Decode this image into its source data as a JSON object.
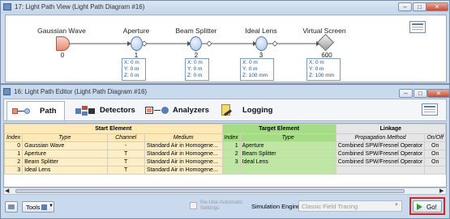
{
  "win17": {
    "title": "17: Light Path View (Light Path Diagram #16)",
    "elements": [
      {
        "name": "Gaussian Wave",
        "index": "0"
      },
      {
        "name": "Aperture",
        "index": "1",
        "x": "X: 0 m",
        "y": "Y: 0 m",
        "z": "Z: 0 m"
      },
      {
        "name": "Beam Splitter",
        "index": "2",
        "x": "X: 0 m",
        "y": "Y: 0 m",
        "z": "Z: 0 m"
      },
      {
        "name": "Ideal Lens",
        "index": "3",
        "x": "X: 0 m",
        "y": "Y: 0 m",
        "z": "Z: 100 mm"
      },
      {
        "name": "Virtual Screen",
        "index": "600",
        "x": "X: 0 m",
        "y": "Y: 0 m",
        "z": "Z: 100 mm"
      }
    ]
  },
  "win16": {
    "title": "16: Light Path Editor (Light Path Diagram #16)",
    "tabs": [
      "Path",
      "Detectors",
      "Analyzers",
      "Logging"
    ]
  },
  "grid": {
    "groups": {
      "start": "Start Element",
      "target": "Target Element",
      "linkage": "Linkage"
    },
    "headers": [
      "Index",
      "Type",
      "Channel",
      "Medium",
      "Index",
      "Type",
      "Propagation Method",
      "On/Off"
    ],
    "rows": [
      [
        "0",
        "Gaussian Wave",
        "-",
        "Standard Air in Homogene...",
        "1",
        "Aperture",
        "Combined SPW/Fresnel Operator",
        "On"
      ],
      [
        "1",
        "Aperture",
        "T",
        "Standard Air in Homogene...",
        "2",
        "Beam Splitter",
        "Combined SPW/Fresnel Operator",
        "On"
      ],
      [
        "2",
        "Beam Splitter",
        "T",
        "Standard Air in Homogene...",
        "3",
        "Ideal Lens",
        "Combined SPW/Fresnel Operator",
        "On"
      ],
      [
        "3",
        "Ideal Lens",
        "T",
        "Standard Air in Homogene...",
        "",
        "",
        "",
        ""
      ]
    ]
  },
  "bottom": {
    "tools": "Tools",
    "reuse": "Re-Use Automatic Settings",
    "engine_label": "Simulation Engine",
    "engine_value": "Classic Field Tracing",
    "go": "Go!"
  }
}
